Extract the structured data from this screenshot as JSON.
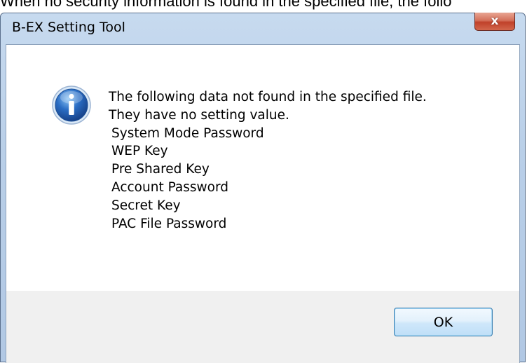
{
  "background_caption": "When no security information is found in the specified file, the follo",
  "dialog": {
    "title": "B-EX Setting Tool",
    "close_label": "x",
    "icon": "information-icon",
    "message": {
      "line1": "The following data not found in the specified file.",
      "line2": "They have no setting value.",
      "items": [
        "System Mode Password",
        "WEP Key",
        "Pre Shared Key",
        "Account Password",
        "Secret Key",
        "PAC File Password"
      ]
    },
    "ok_label": "OK"
  },
  "colors": {
    "frame": "#b9cfe8",
    "close_button": "#c0412a",
    "ok_border": "#3c7fb1",
    "icon_blue": "#2a6dc4"
  }
}
